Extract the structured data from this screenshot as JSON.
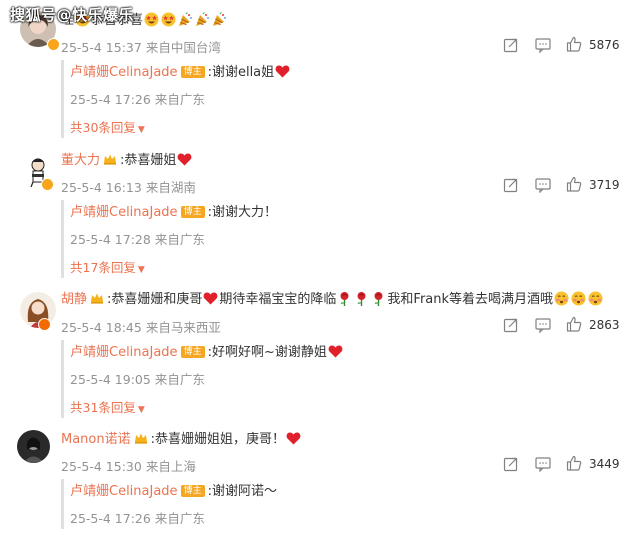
{
  "watermark": "搜狐号@快乐爆乐",
  "comments": [
    {
      "name": "",
      "text_prefix": "哇",
      "text_mid": "恭喜恭喜",
      "time": "25-5-4 15:37",
      "location": "来自中国台湾",
      "likes": "5876",
      "reply": {
        "name": "卢靖姗CelinaJade",
        "tag": "博主",
        "text": ":谢谢ella姐",
        "time": "25-5-4 17:26",
        "location": "来自广东"
      },
      "more": "共30条回复"
    },
    {
      "name": "董大力",
      "text": ":恭喜姗姐",
      "time": "25-5-4 16:13",
      "location": "来自湖南",
      "likes": "3719",
      "reply": {
        "name": "卢靖姗CelinaJade",
        "tag": "博主",
        "text": ":谢谢大力！",
        "time": "25-5-4 17:28",
        "location": "来自广东"
      },
      "more": "共17条回复"
    },
    {
      "name": "胡静",
      "text_a": ":恭喜姗姗和庚哥",
      "text_b": "期待幸福宝宝的降临",
      "text_c": "我和Frank等着去喝满月酒哦",
      "time": "25-5-4 18:45",
      "location": "来自马来西亚",
      "likes": "2863",
      "reply": {
        "name": "卢靖姗CelinaJade",
        "tag": "博主",
        "text": ":好啊好啊~谢谢静姐",
        "time": "25-5-4 19:05",
        "location": "来自广东"
      },
      "more": "共31条回复"
    },
    {
      "name": "Manon诺诺",
      "text": ":恭喜姗姗姐姐，庚哥！",
      "time": "25-5-4 15:30",
      "location": "来自上海",
      "likes": "3449",
      "reply": {
        "name": "卢靖姗CelinaJade",
        "tag": "博主",
        "text": ":谢谢阿诺～",
        "time": "25-5-4 17:26",
        "location": "来自广东"
      }
    }
  ],
  "colors": {
    "accent": "#eb7350",
    "meta": "#939393",
    "reply_bg": "#f7f7f7",
    "tag": "#f5a623"
  },
  "icons": [
    "share-icon",
    "comment-icon",
    "like-icon",
    "heart-emoji",
    "star-eyes-emoji",
    "party-popper-emoji",
    "rose-emoji",
    "shy-emoji",
    "crown-icon",
    "verified-badge"
  ]
}
